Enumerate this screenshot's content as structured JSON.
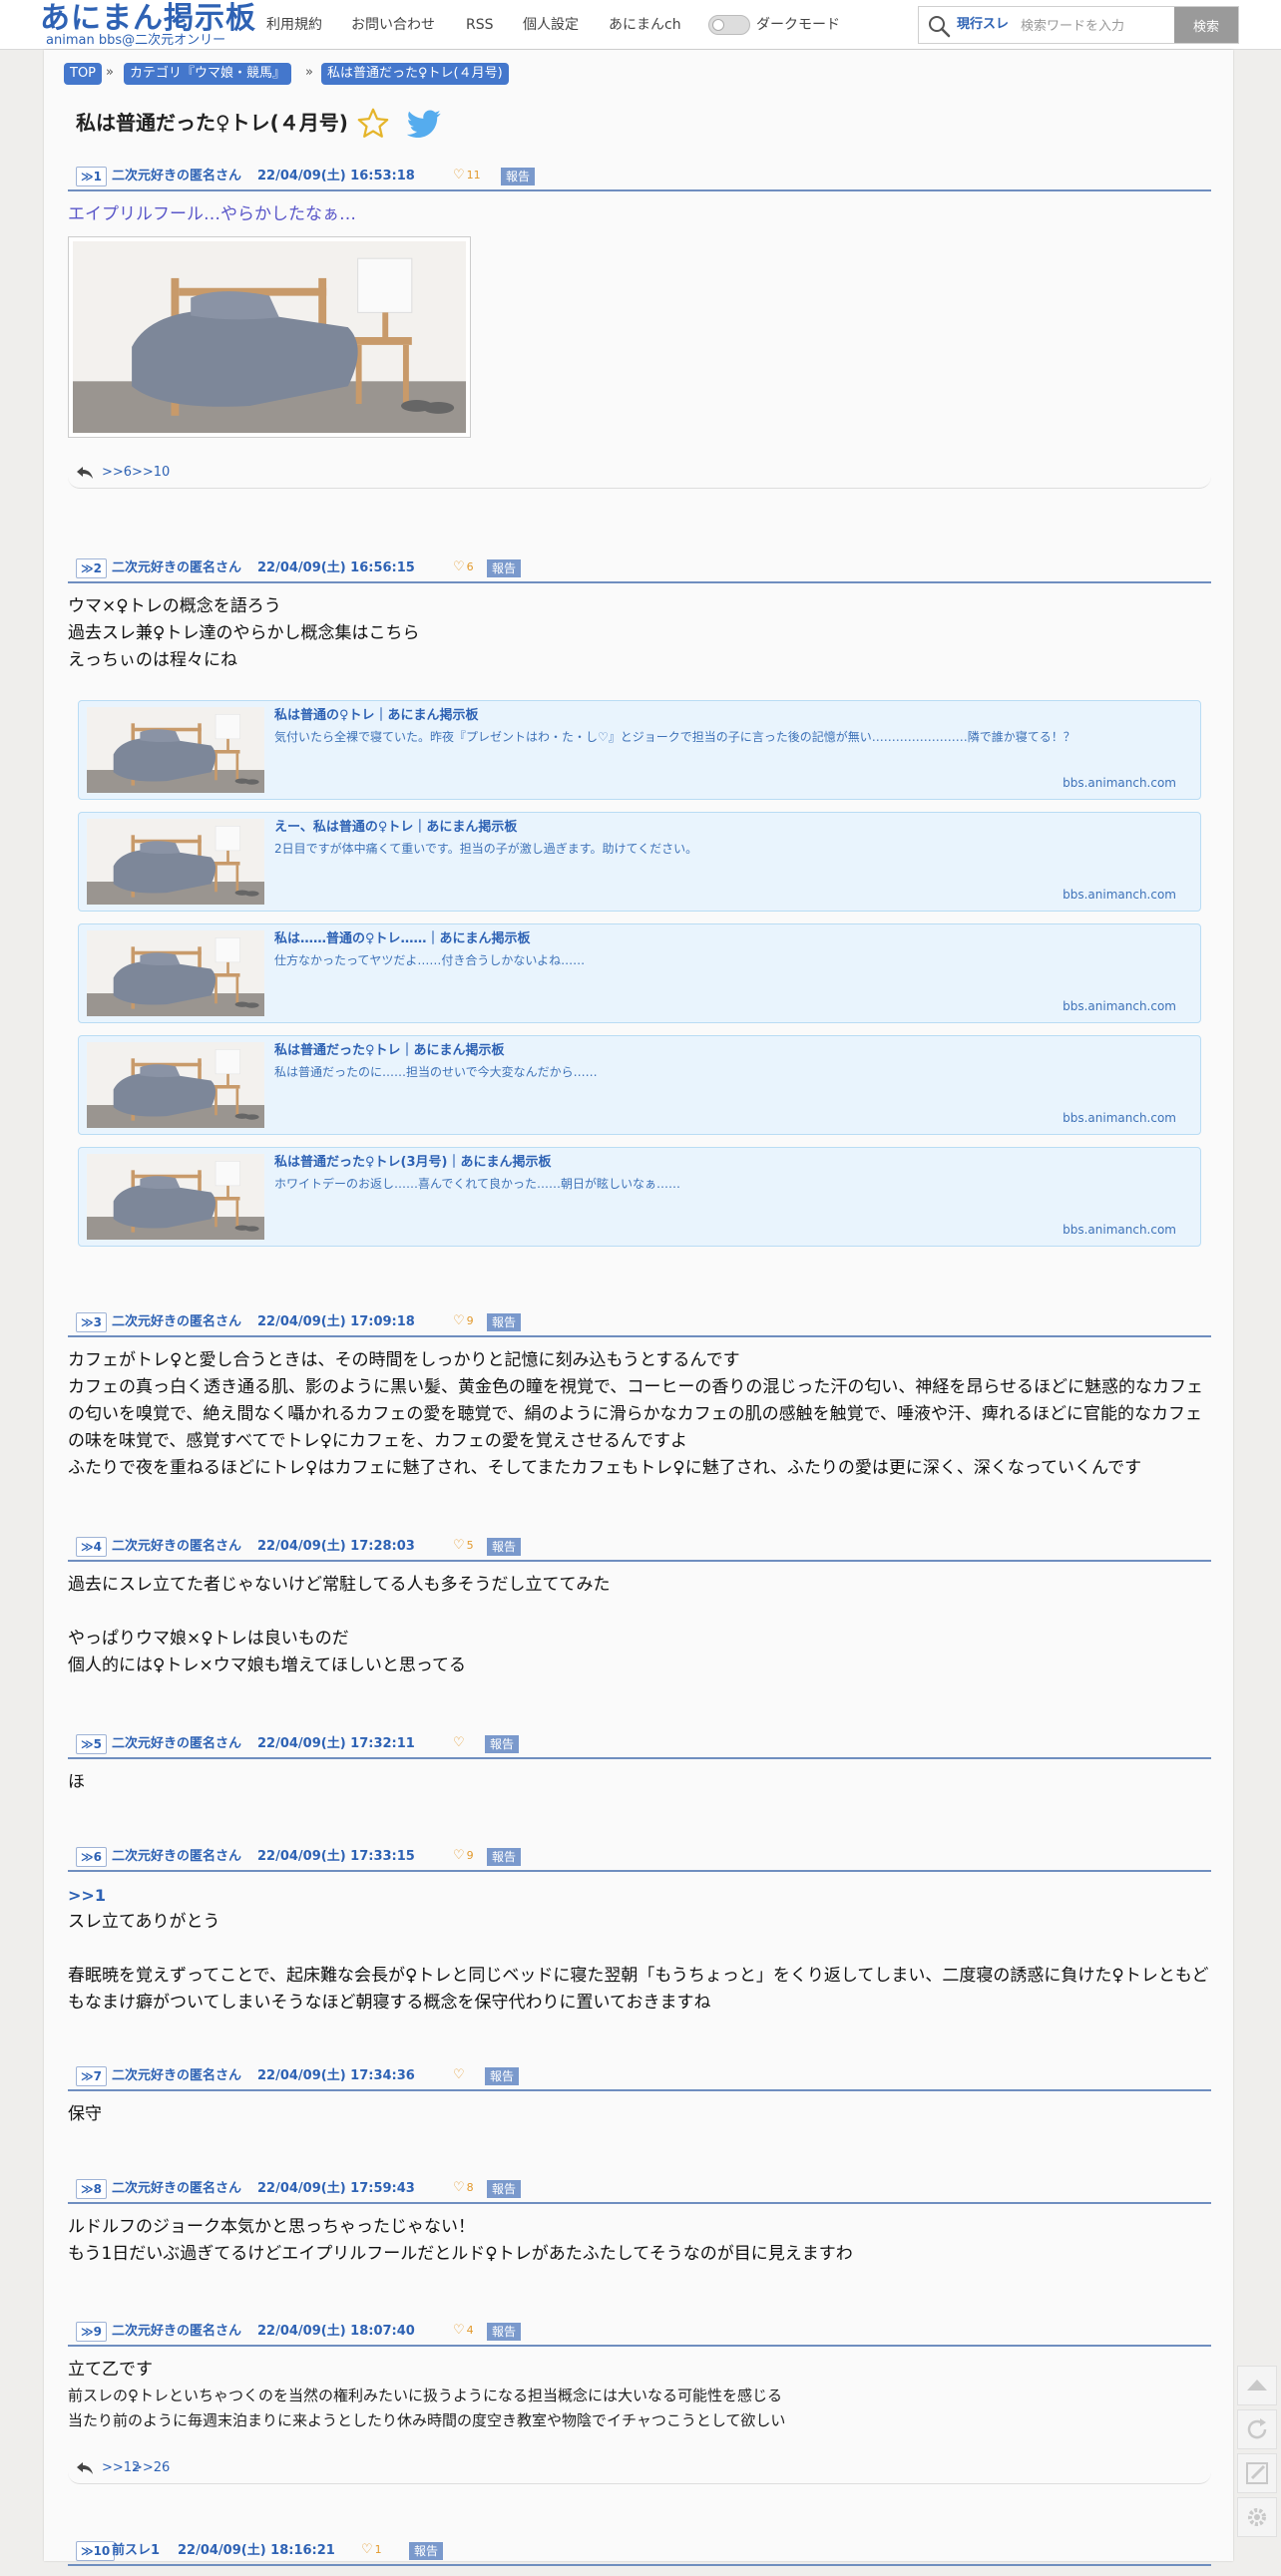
{
  "header": {
    "logo_main": "あにまん掲示板",
    "logo_sub": "animan bbs@二次元オンリー",
    "nav": [
      "利用規約",
      "お問い合わせ",
      "RSS",
      "個人設定",
      "あにまんch"
    ],
    "dark_mode_label": "ダークモード",
    "search_scope": "現行スレ",
    "search_placeholder": "検索ワードを入力",
    "search_button": "検索"
  },
  "breadcrumb": [
    "TOP",
    "カテゴリ『ウマ娘・競馬』",
    "私は普通だった♀トレ(４月号)"
  ],
  "breadcrumb_sep": "»",
  "thread_title": "私は普通だった♀トレ(４月号)",
  "posts": [
    {
      "num": "≫1",
      "name": "二次元好きの匿名さん",
      "date": "22/04/09(土) 16:53:18",
      "likes": "11",
      "report": "報告",
      "lines": [
        "エイプリルフール…やらかしたなぁ…"
      ],
      "replies": [
        ">>6",
        ">>10"
      ]
    },
    {
      "num": "≫2",
      "name": "二次元好きの匿名さん",
      "date": "22/04/09(土) 16:56:15",
      "likes": "6",
      "report": "報告",
      "lines": [
        "ウマ×♀トレの概念を語ろう",
        "過去スレ兼♀トレ達のやらかし概念集はこちら",
        "えっちぃのは程々にね"
      ],
      "cards": [
        {
          "title": "私は普通の♀トレ｜あにまん掲示板",
          "desc": "気付いたら全裸で寝ていた。昨夜『プレゼントはわ・た・し♡』とジョークで担当の子に言った後の記憶が無い……………………隣で誰か寝てる！？",
          "domain": "bbs.animanch.com"
        },
        {
          "title": "えー、私は普通の♀トレ｜あにまん掲示板",
          "desc": "2日目ですが体中痛くて重いです。担当の子が激し過ぎます。助けてください。",
          "domain": "bbs.animanch.com"
        },
        {
          "title": "私は……普通の♀トレ……｜あにまん掲示板",
          "desc": "仕方なかったってヤツだよ……付き合うしかないよね……",
          "domain": "bbs.animanch.com"
        },
        {
          "title": "私は普通だった♀トレ｜あにまん掲示板",
          "desc": "私は普通だったのに……担当のせいで今大変なんだから……",
          "domain": "bbs.animanch.com"
        },
        {
          "title": "私は普通だった♀トレ(3月号)｜あにまん掲示板",
          "desc": "ホワイトデーのお返し……喜んでくれて良かった……朝日が眩しいなぁ……",
          "domain": "bbs.animanch.com"
        }
      ]
    },
    {
      "num": "≫3",
      "name": "二次元好きの匿名さん",
      "date": "22/04/09(土) 17:09:18",
      "likes": "9",
      "report": "報告",
      "lines": [
        "カフェがトレ♀と愛し合うときは、その時間をしっかりと記憶に刻み込もうとするんです",
        "カフェの真っ白く透き通る肌、影のように黒い髪、黄金色の瞳を視覚で、コーヒーの香りの混じった汗の匂い、神経を昂らせるほどに魅惑的なカフェの匂いを嗅覚で、絶え間なく囁かれるカフェの愛を聴覚で、絹のように滑らかなカフェの肌の感触を触覚で、唾液や汗、痺れるほどに官能的なカフェの味を味覚で、感覚すべてでトレ♀にカフェを、カフェの愛を覚えさせるんですよ",
        "ふたりで夜を重ねるほどにトレ♀はカフェに魅了され、そしてまたカフェもトレ♀に魅了され、ふたりの愛は更に深く、深くなっていくんです"
      ]
    },
    {
      "num": "≫4",
      "name": "二次元好きの匿名さん",
      "date": "22/04/09(土) 17:28:03",
      "likes": "5",
      "report": "報告",
      "lines": [
        "過去にスレ立てた者じゃないけど常駐してる人も多そうだし立ててみた",
        "",
        "やっぱりウマ娘×♀トレは良いものだ",
        "個人的には♀トレ×ウマ娘も増えてほしいと思ってる"
      ]
    },
    {
      "num": "≫5",
      "name": "二次元好きの匿名さん",
      "date": "22/04/09(土) 17:32:11",
      "likes": "",
      "report": "報告",
      "lines": [
        "ほ"
      ]
    },
    {
      "num": "≫6",
      "name": "二次元好きの匿名さん",
      "date": "22/04/09(土) 17:33:15",
      "likes": "9",
      "report": "報告",
      "anchor": ">>1",
      "lines": [
        "スレ立てありがとう",
        "",
        "春眠暁を覚えずってことで、起床難な会長が♀トレと同じベッドに寝た翌朝「もうちょっと」をくり返してしまい、二度寝の誘惑に負けた♀トレともどもなまけ癖がついてしまいそうなほど朝寝する概念を保守代わりに置いておきますね"
      ]
    },
    {
      "num": "≫7",
      "name": "二次元好きの匿名さん",
      "date": "22/04/09(土) 17:34:36",
      "likes": "",
      "report": "報告",
      "lines": [
        "保守"
      ]
    },
    {
      "num": "≫8",
      "name": "二次元好きの匿名さん",
      "date": "22/04/09(土) 17:59:43",
      "likes": "8",
      "report": "報告",
      "lines": [
        "ルドルフのジョーク本気かと思っちゃったじゃない！",
        "もう1日だいぶ過ぎてるけどエイプリルフールだとルド♀トレがあたふたしてそうなのが目に見えますわ"
      ]
    },
    {
      "num": "≫9",
      "name": "二次元好きの匿名さん",
      "date": "22/04/09(土) 18:07:40",
      "likes": "4",
      "report": "報告",
      "lines": [
        "立て乙です",
        "前スレの♀トレといちゃつくのを当然の権利みたいに扱うようになる担当概念には大いなる可能性を感じる",
        "当たり前のように毎週末泊まりに来ようとしたり休み時間の度空き教室や物陰でイチャつこうとして欲しい"
      ],
      "replies": [
        ">>12",
        ">>26"
      ]
    },
    {
      "num": "≫10",
      "name": "前スレ1",
      "date": "22/04/09(土) 18:16:21",
      "likes": "1",
      "report": "報告",
      "lines": []
    }
  ]
}
